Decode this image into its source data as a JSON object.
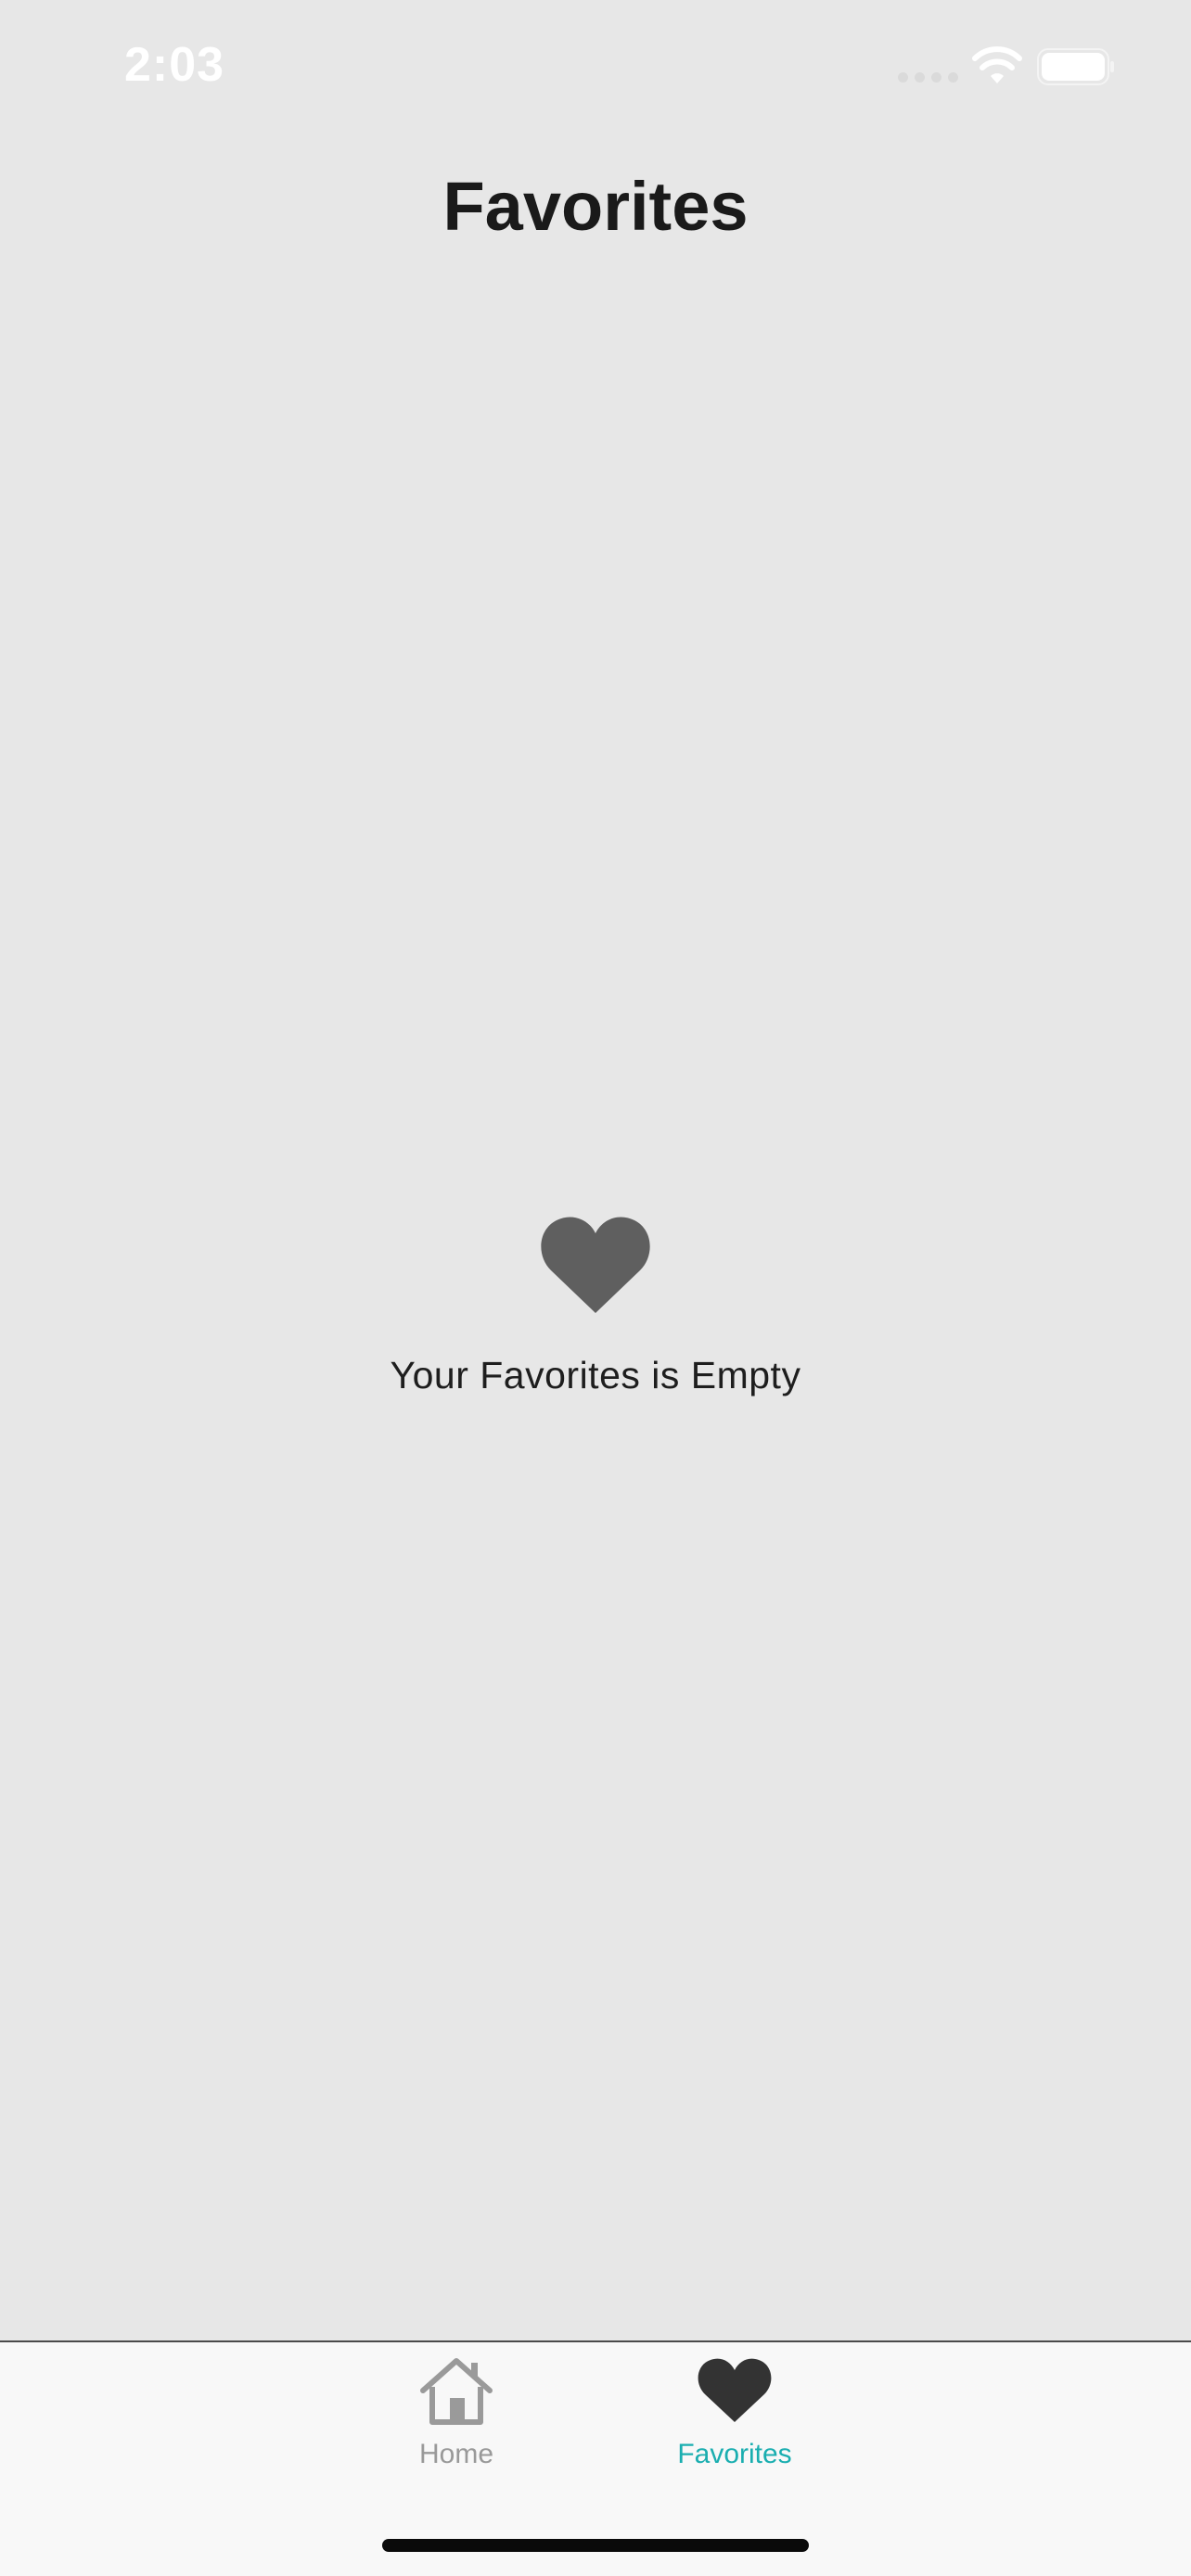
{
  "status_bar": {
    "time": "2:03",
    "icons": [
      "cellular-signal-icon",
      "wifi-icon",
      "battery-icon"
    ]
  },
  "header": {
    "title": "Favorites"
  },
  "empty_state": {
    "icon": "heart-icon",
    "message": "Your Favorites is Empty"
  },
  "tab_bar": {
    "tabs": [
      {
        "label": "Home",
        "icon": "home-icon",
        "active": false
      },
      {
        "label": "Favorites",
        "icon": "heart-icon",
        "active": true
      }
    ]
  },
  "colors": {
    "background": "#e7e7e7",
    "tab_active": "#1aaeb0",
    "tab_inactive": "#999999",
    "empty_icon": "#5f5f5f"
  }
}
